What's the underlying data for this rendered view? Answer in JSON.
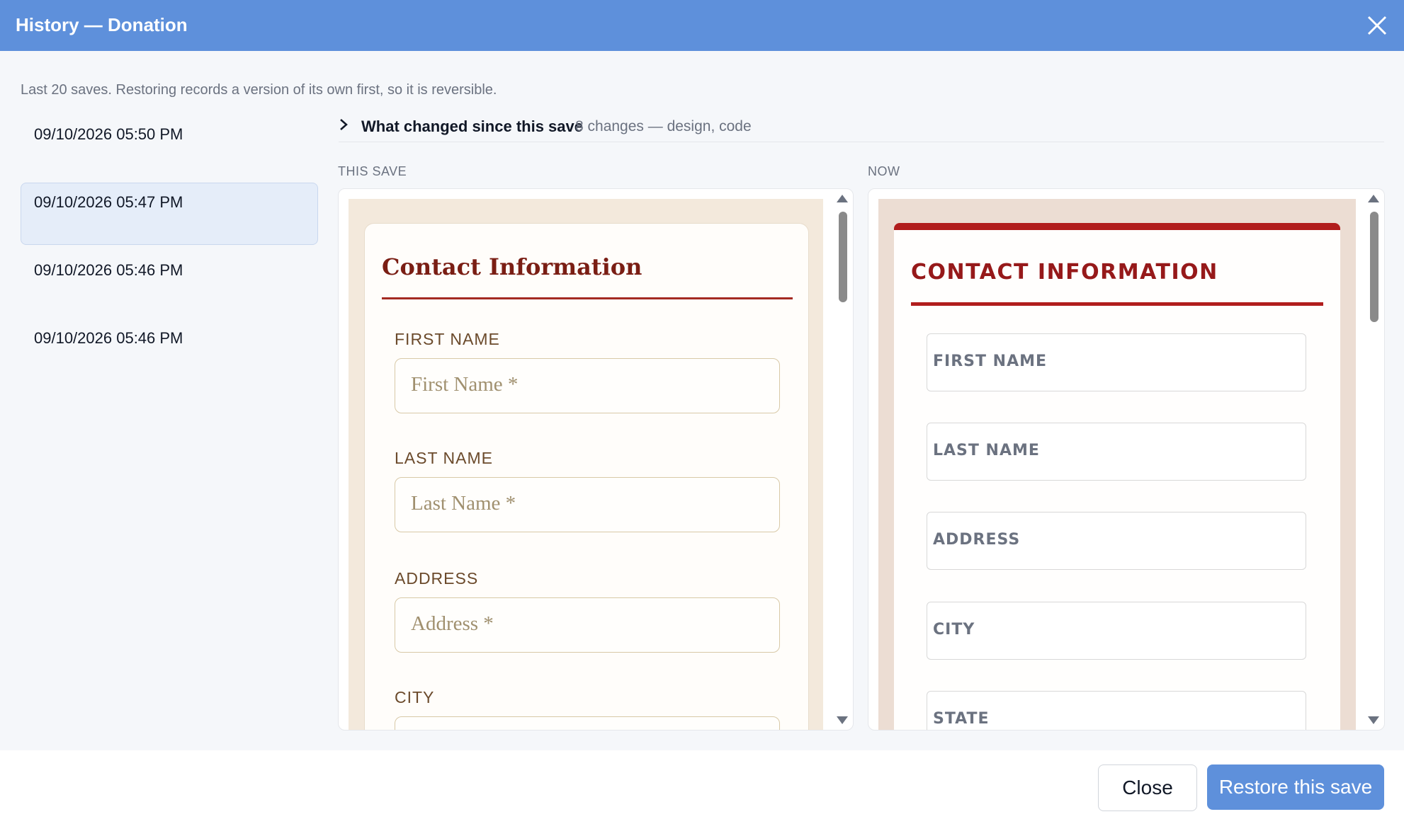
{
  "dialog": {
    "title": "History — Donation",
    "close_icon": "close-icon"
  },
  "note": "Last 20 saves. Restoring records a version of its own first, so it is reversible.",
  "history": {
    "items": [
      {
        "label": "09/10/2026 05:50 PM",
        "selected": false
      },
      {
        "label": "09/10/2026 05:47 PM",
        "selected": true
      },
      {
        "label": "09/10/2026 05:46 PM",
        "selected": false
      },
      {
        "label": "09/10/2026 05:46 PM",
        "selected": false
      }
    ]
  },
  "changes": {
    "toggle_icon": "chevron-right-icon",
    "label": "What changed since this save",
    "summary": "8 changes — design, code"
  },
  "this_save": {
    "column_label": "THIS SAVE",
    "heading": "Contact Information",
    "fields": [
      {
        "label": "FIRST NAME",
        "placeholder": "First Name *"
      },
      {
        "label": "LAST NAME",
        "placeholder": "Last Name *"
      },
      {
        "label": "ADDRESS",
        "placeholder": "Address *"
      },
      {
        "label": "CITY",
        "placeholder": ""
      }
    ]
  },
  "now": {
    "column_label": "NOW",
    "heading": "CONTACT INFORMATION",
    "fields": [
      {
        "label": "FIRST NAME"
      },
      {
        "label": "LAST NAME"
      },
      {
        "label": "ADDRESS"
      },
      {
        "label": "CITY"
      },
      {
        "label": "STATE"
      }
    ]
  },
  "footer": {
    "close_label": "Close",
    "restore_label": "Restore this save"
  },
  "colors": {
    "accent": "#5e90db",
    "now_red": "#b11d1d",
    "this_save_heading": "#7a1e14"
  }
}
